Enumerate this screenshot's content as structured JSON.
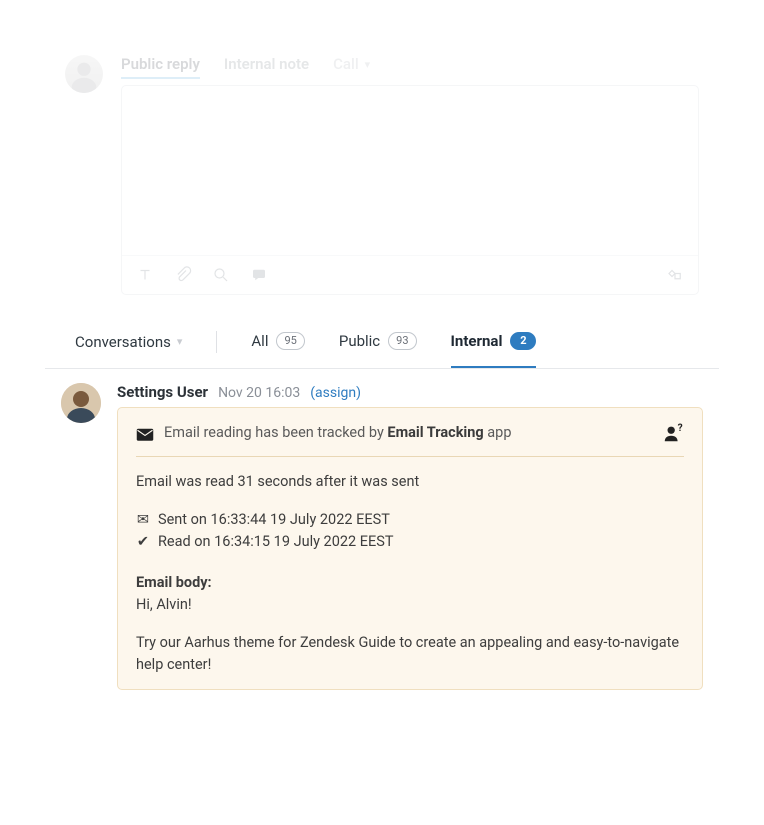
{
  "compose": {
    "tabs": {
      "public": "Public reply",
      "internal": "Internal note",
      "call": "Call"
    }
  },
  "filters": {
    "conversations": "Conversations",
    "all": {
      "label": "All",
      "count": "95"
    },
    "public": {
      "label": "Public",
      "count": "93"
    },
    "internal": {
      "label": "Internal",
      "count": "2"
    }
  },
  "message": {
    "user": "Settings User",
    "timestamp": "Nov 20 16:03",
    "assign": "(assign)",
    "tracking_prefix": "Email reading has been tracked by ",
    "tracking_app": "Email Tracking",
    "tracking_suffix": " app",
    "read_delay": "Email was read 31 seconds after it was sent",
    "sent_line": "Sent on 16:33:44 19 July 2022 EEST",
    "read_line": "Read on 16:34:15 19 July 2022 EEST",
    "body_label": "Email body:",
    "body_greeting": "Hi, Alvin!",
    "body_text": "Try our Aarhus theme for Zendesk Guide to create an appealing and easy-to-navigate help center!"
  }
}
